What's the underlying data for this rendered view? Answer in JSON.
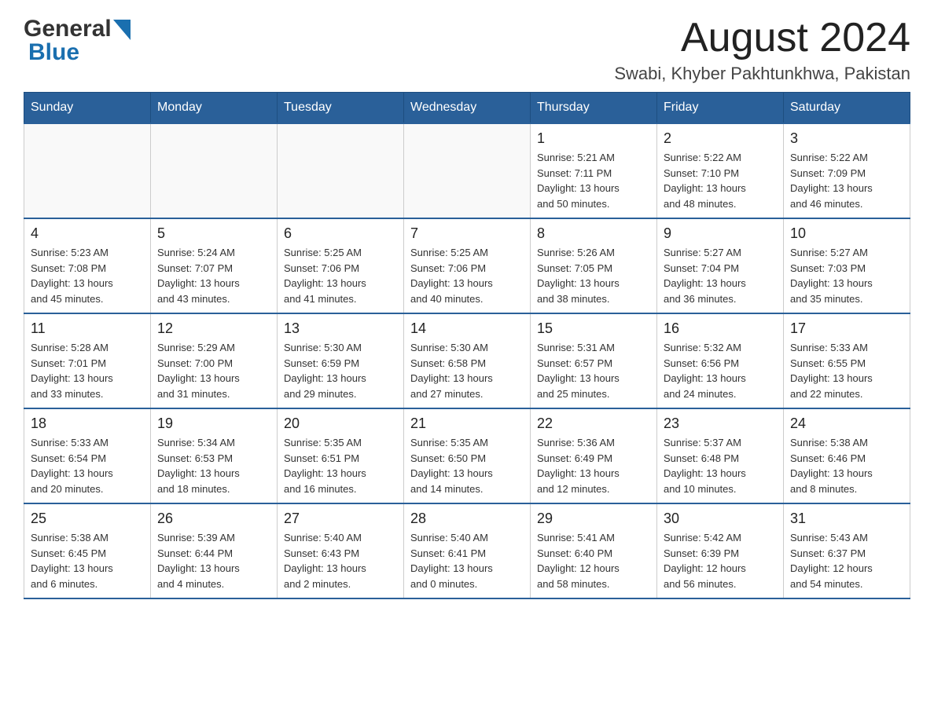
{
  "header": {
    "logo_general": "General",
    "logo_blue": "Blue",
    "month_title": "August 2024",
    "location": "Swabi, Khyber Pakhtunkhwa, Pakistan"
  },
  "weekdays": [
    "Sunday",
    "Monday",
    "Tuesday",
    "Wednesday",
    "Thursday",
    "Friday",
    "Saturday"
  ],
  "weeks": [
    [
      {
        "day": "",
        "info": ""
      },
      {
        "day": "",
        "info": ""
      },
      {
        "day": "",
        "info": ""
      },
      {
        "day": "",
        "info": ""
      },
      {
        "day": "1",
        "info": "Sunrise: 5:21 AM\nSunset: 7:11 PM\nDaylight: 13 hours\nand 50 minutes."
      },
      {
        "day": "2",
        "info": "Sunrise: 5:22 AM\nSunset: 7:10 PM\nDaylight: 13 hours\nand 48 minutes."
      },
      {
        "day": "3",
        "info": "Sunrise: 5:22 AM\nSunset: 7:09 PM\nDaylight: 13 hours\nand 46 minutes."
      }
    ],
    [
      {
        "day": "4",
        "info": "Sunrise: 5:23 AM\nSunset: 7:08 PM\nDaylight: 13 hours\nand 45 minutes."
      },
      {
        "day": "5",
        "info": "Sunrise: 5:24 AM\nSunset: 7:07 PM\nDaylight: 13 hours\nand 43 minutes."
      },
      {
        "day": "6",
        "info": "Sunrise: 5:25 AM\nSunset: 7:06 PM\nDaylight: 13 hours\nand 41 minutes."
      },
      {
        "day": "7",
        "info": "Sunrise: 5:25 AM\nSunset: 7:06 PM\nDaylight: 13 hours\nand 40 minutes."
      },
      {
        "day": "8",
        "info": "Sunrise: 5:26 AM\nSunset: 7:05 PM\nDaylight: 13 hours\nand 38 minutes."
      },
      {
        "day": "9",
        "info": "Sunrise: 5:27 AM\nSunset: 7:04 PM\nDaylight: 13 hours\nand 36 minutes."
      },
      {
        "day": "10",
        "info": "Sunrise: 5:27 AM\nSunset: 7:03 PM\nDaylight: 13 hours\nand 35 minutes."
      }
    ],
    [
      {
        "day": "11",
        "info": "Sunrise: 5:28 AM\nSunset: 7:01 PM\nDaylight: 13 hours\nand 33 minutes."
      },
      {
        "day": "12",
        "info": "Sunrise: 5:29 AM\nSunset: 7:00 PM\nDaylight: 13 hours\nand 31 minutes."
      },
      {
        "day": "13",
        "info": "Sunrise: 5:30 AM\nSunset: 6:59 PM\nDaylight: 13 hours\nand 29 minutes."
      },
      {
        "day": "14",
        "info": "Sunrise: 5:30 AM\nSunset: 6:58 PM\nDaylight: 13 hours\nand 27 minutes."
      },
      {
        "day": "15",
        "info": "Sunrise: 5:31 AM\nSunset: 6:57 PM\nDaylight: 13 hours\nand 25 minutes."
      },
      {
        "day": "16",
        "info": "Sunrise: 5:32 AM\nSunset: 6:56 PM\nDaylight: 13 hours\nand 24 minutes."
      },
      {
        "day": "17",
        "info": "Sunrise: 5:33 AM\nSunset: 6:55 PM\nDaylight: 13 hours\nand 22 minutes."
      }
    ],
    [
      {
        "day": "18",
        "info": "Sunrise: 5:33 AM\nSunset: 6:54 PM\nDaylight: 13 hours\nand 20 minutes."
      },
      {
        "day": "19",
        "info": "Sunrise: 5:34 AM\nSunset: 6:53 PM\nDaylight: 13 hours\nand 18 minutes."
      },
      {
        "day": "20",
        "info": "Sunrise: 5:35 AM\nSunset: 6:51 PM\nDaylight: 13 hours\nand 16 minutes."
      },
      {
        "day": "21",
        "info": "Sunrise: 5:35 AM\nSunset: 6:50 PM\nDaylight: 13 hours\nand 14 minutes."
      },
      {
        "day": "22",
        "info": "Sunrise: 5:36 AM\nSunset: 6:49 PM\nDaylight: 13 hours\nand 12 minutes."
      },
      {
        "day": "23",
        "info": "Sunrise: 5:37 AM\nSunset: 6:48 PM\nDaylight: 13 hours\nand 10 minutes."
      },
      {
        "day": "24",
        "info": "Sunrise: 5:38 AM\nSunset: 6:46 PM\nDaylight: 13 hours\nand 8 minutes."
      }
    ],
    [
      {
        "day": "25",
        "info": "Sunrise: 5:38 AM\nSunset: 6:45 PM\nDaylight: 13 hours\nand 6 minutes."
      },
      {
        "day": "26",
        "info": "Sunrise: 5:39 AM\nSunset: 6:44 PM\nDaylight: 13 hours\nand 4 minutes."
      },
      {
        "day": "27",
        "info": "Sunrise: 5:40 AM\nSunset: 6:43 PM\nDaylight: 13 hours\nand 2 minutes."
      },
      {
        "day": "28",
        "info": "Sunrise: 5:40 AM\nSunset: 6:41 PM\nDaylight: 13 hours\nand 0 minutes."
      },
      {
        "day": "29",
        "info": "Sunrise: 5:41 AM\nSunset: 6:40 PM\nDaylight: 12 hours\nand 58 minutes."
      },
      {
        "day": "30",
        "info": "Sunrise: 5:42 AM\nSunset: 6:39 PM\nDaylight: 12 hours\nand 56 minutes."
      },
      {
        "day": "31",
        "info": "Sunrise: 5:43 AM\nSunset: 6:37 PM\nDaylight: 12 hours\nand 54 minutes."
      }
    ]
  ]
}
